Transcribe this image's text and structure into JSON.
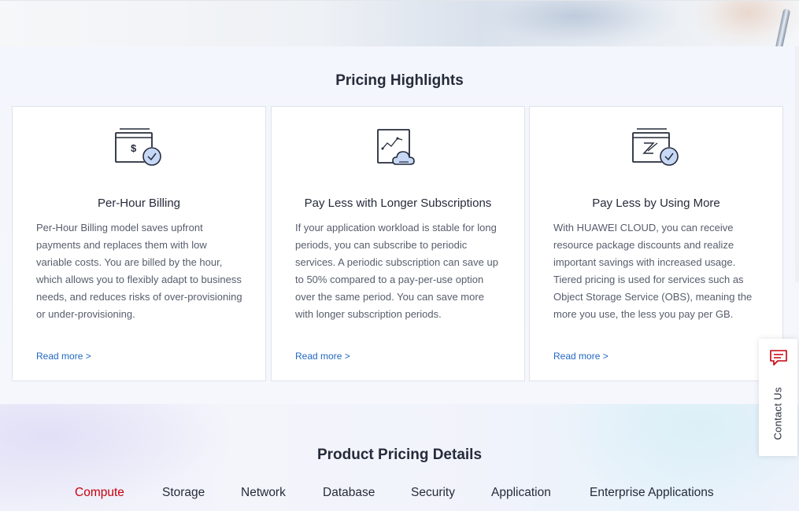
{
  "highlights": {
    "title": "Pricing Highlights",
    "cards": [
      {
        "icon": "billing-dollar-icon",
        "title": "Per-Hour Billing",
        "description": "Per-Hour Billing model saves upfront payments and replaces them with low variable costs. You are billed by the hour, which allows you to flexibly adapt to business needs, and reduces risks of over-provisioning or under-provisioning.",
        "link": "Read more >"
      },
      {
        "icon": "cloud-chart-icon",
        "title": "Pay Less with Longer Subscriptions",
        "description": "If your application workload is stable for long periods, you can subscribe to periodic services. A periodic subscription can save up to 50% compared to a pay-per-use option over the same period. You can save more with longer subscription periods.",
        "link": "Read more >"
      },
      {
        "icon": "tiered-storage-icon",
        "title": "Pay Less by Using More",
        "description": "With HUAWEI CLOUD, you can receive resource package discounts and realize important savings with increased usage. Tiered pricing is used for services such as Object Storage Service (OBS), meaning the more you use, the less you pay per GB.",
        "link": "Read more >"
      }
    ]
  },
  "details": {
    "title": "Product Pricing Details",
    "tabs": [
      "Compute",
      "Storage",
      "Network",
      "Database",
      "Security",
      "Application",
      "Enterprise Applications"
    ],
    "active_tab": "Compute"
  },
  "contact": {
    "label": "Contact Us",
    "icon": "chat-icon"
  },
  "colors": {
    "accent_red": "#c7000b",
    "link_blue": "#2268c2",
    "text_dark": "#252b3a",
    "text_body": "#575d6c"
  }
}
